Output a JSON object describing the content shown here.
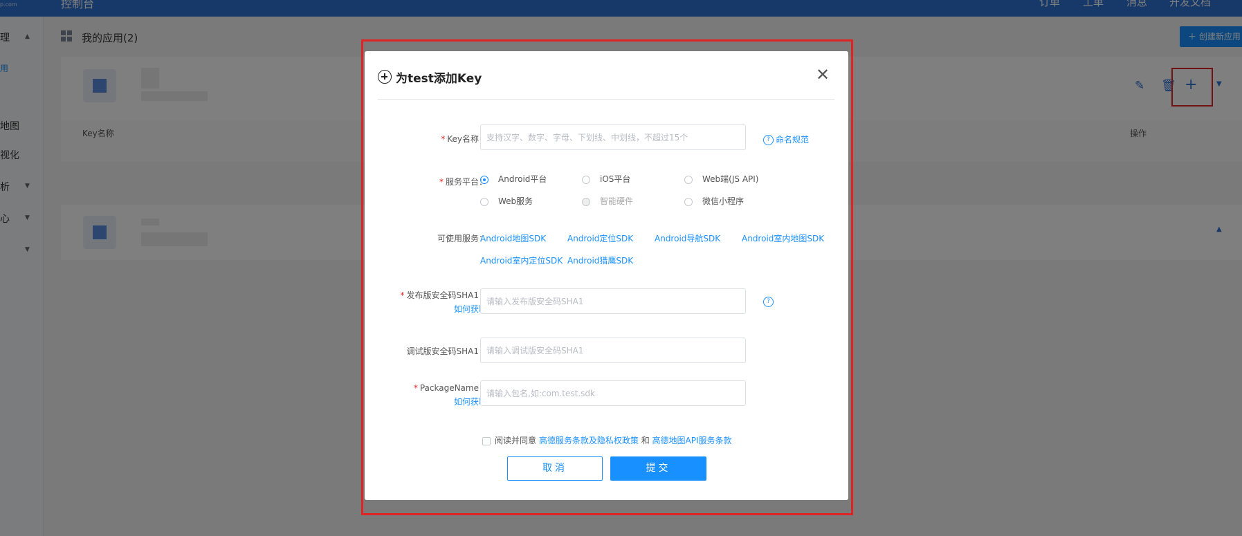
{
  "topbar": {
    "logo_sub": "p.com",
    "console_title": "控制台",
    "nav": [
      "订单",
      "工单",
      "消息",
      "开发文档"
    ]
  },
  "sidebar": {
    "items": [
      "理",
      "用",
      "地图",
      "视化",
      "析",
      "心"
    ]
  },
  "main": {
    "page_title": "我的应用(2)",
    "create_button": "创建新应用",
    "table_headers": {
      "key_name": "Key名称",
      "actions": "操作"
    }
  },
  "modal": {
    "title": "为test添加Key",
    "fields": {
      "key_name": {
        "label": "Key名称：",
        "placeholder": "支持汉字、数字、字母、下划线、中划线，不超过15个",
        "help": "命名规范"
      },
      "platform": {
        "label": "服务平台：",
        "options": [
          {
            "label": "Android平台",
            "state": "checked"
          },
          {
            "label": "iOS平台",
            "state": "normal"
          },
          {
            "label": "Web端(JS API)",
            "state": "normal"
          },
          {
            "label": "Web服务",
            "state": "normal"
          },
          {
            "label": "智能硬件",
            "state": "disabled"
          },
          {
            "label": "微信小程序",
            "state": "normal"
          }
        ]
      },
      "services": {
        "label": "可使用服务：",
        "items": [
          "Android地图SDK",
          "Android定位SDK",
          "Android导航SDK",
          "Android室内地图SDK",
          "Android室内定位SDK",
          "Android猎鹰SDK"
        ]
      },
      "release_sha1": {
        "label": "发布版安全码SHA1：",
        "sublink": "如何获取",
        "placeholder": "请输入发布版安全码SHA1"
      },
      "debug_sha1": {
        "label": "调试版安全码SHA1：",
        "placeholder": "请输入调试版安全码SHA1"
      },
      "package_name": {
        "label": "PackageName：",
        "sublink": "如何获取",
        "placeholder": "请输入包名,如:com.test.sdk"
      }
    },
    "agreement": {
      "prefix": "阅读并同意",
      "link1": "高德服务条款及隐私权政策",
      "conj": "和",
      "link2": "高德地图API服务条款"
    },
    "cancel_label": "取消",
    "submit_label": "提交"
  },
  "colors": {
    "primary": "#1890ff",
    "topbar": "#2f73d3",
    "highlight": "#e02424",
    "required": "#e02424"
  }
}
